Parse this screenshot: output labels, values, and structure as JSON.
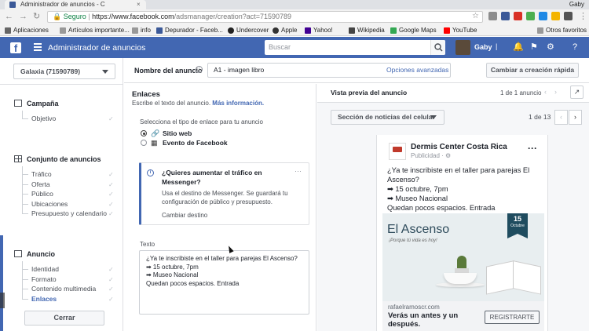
{
  "browser": {
    "tab_title": "Administrador de anuncios - C",
    "tab_close": "×",
    "user": "Gaby",
    "url_secure": "Seguro",
    "url_host": "https://www.facebook.com",
    "url_path": "/adsmanager/creation?act=71590789",
    "bookmarks": [
      "Aplicaciones",
      "Artículos importante...",
      "info",
      "Depurador - Faceb...",
      "Undercover",
      "Apple",
      "Yahoo!",
      "Wikipedia",
      "Google Maps",
      "YouTube",
      "Otros favoritos"
    ]
  },
  "header": {
    "title": "Administrador de anuncios",
    "search_placeholder": "Buscar",
    "user": "Gaby"
  },
  "account": {
    "selector": "Galaxia (71590789)"
  },
  "nav": {
    "campaign": {
      "title": "Campaña",
      "items": [
        "Objetivo"
      ]
    },
    "adset": {
      "title": "Conjunto de anuncios",
      "items": [
        "Tráfico",
        "Oferta",
        "Público",
        "Ubicaciones",
        "Presupuesto y calendario"
      ]
    },
    "ad": {
      "title": "Anuncio",
      "items": [
        "Identidad",
        "Formato",
        "Contenido multimedia",
        "Enlaces"
      ]
    },
    "close_button": "Cerrar"
  },
  "editor": {
    "ad_name_label": "Nombre del anuncio",
    "ad_name_value": "A1 - imagen libro",
    "advanced_options": "Opciones avanzadas",
    "quick_create": "Cambiar a creación rápida"
  },
  "links": {
    "title": "Enlaces",
    "subtitle": "Escribe el texto del anuncio.",
    "more_info": "Más información.",
    "select_type": "Selecciona el tipo de enlace para tu anuncio",
    "options": [
      "Sitio web",
      "Evento de Facebook"
    ],
    "info_title": "¿Quieres aumentar el tráfico en Messenger?",
    "info_body": "Usa el destino de Messenger. Se guardará tu configuración de público y presupuesto.",
    "info_link": "Cambiar destino",
    "info_menu": "···",
    "text_label": "Texto",
    "text_value": "¿Ya te inscribiste en el taller para parejas El Ascenso?\n➡ 15 octubre, 7pm\n➡ Museo Nacional\nQuedan pocos espacios. Entrada"
  },
  "preview": {
    "title": "Vista previa del anuncio",
    "count": "1 de 1 anuncio",
    "placement": "Sección de noticias del celular",
    "page_count": "1 de 13",
    "page_name": "Dermis Center Costa Rica",
    "page_sub": "Publicidad · ⚙",
    "post_text": "¿Ya te inscribiste en el taller para parejas El Ascenso?\n➡ 15 octubre, 7pm\n➡ Museo Nacional\nQuedan pocos espacios. Entrada",
    "image_title": "El Ascenso",
    "image_subtitle": "¡Porque tú vida es hoy!",
    "ribbon_day": "15",
    "ribbon_month": "Octubre",
    "link_url": "rafaelramoscr.com",
    "link_headline": "Verás un antes y un después.",
    "cta": "REGISTRARTE"
  },
  "colors": {
    "fb_blue": "#4267b2",
    "link": "#4267b2"
  }
}
